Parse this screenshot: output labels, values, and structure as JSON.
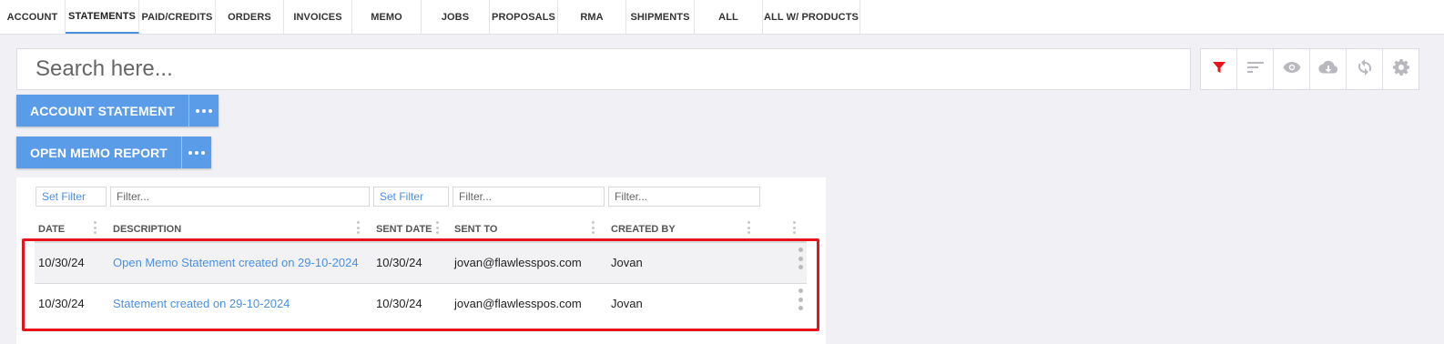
{
  "tabs": [
    {
      "label": "ACCOUNT",
      "active": false
    },
    {
      "label": "STATEMENTS",
      "active": true
    },
    {
      "label": "PAID/CREDITS",
      "active": false
    },
    {
      "label": "ORDERS",
      "active": false
    },
    {
      "label": "INVOICES",
      "active": false
    },
    {
      "label": "MEMO",
      "active": false
    },
    {
      "label": "JOBS",
      "active": false
    },
    {
      "label": "PROPOSALS",
      "active": false
    },
    {
      "label": "RMA",
      "active": false
    },
    {
      "label": "SHIPMENTS",
      "active": false
    },
    {
      "label": "ALL",
      "active": false
    },
    {
      "label": "ALL W/ PRODUCTS",
      "active": false
    }
  ],
  "search": {
    "placeholder": "Search here..."
  },
  "toolbar": {
    "icons": [
      "filter-icon",
      "sort-icon",
      "eye-icon",
      "cloud-download-icon",
      "sync-icon",
      "gear-icon"
    ],
    "filter_color": "#e8141b",
    "icon_color": "#b8b8be"
  },
  "actions": {
    "account_statement": "ACCOUNT STATEMENT",
    "open_memo_report": "OPEN MEMO REPORT",
    "button_color": "#5b9ce8"
  },
  "filters": {
    "set_filter_1": "Set Filter",
    "filter_placeholder_1": "Filter...",
    "set_filter_2": "Set Filter",
    "filter_placeholder_2": "Filter...",
    "filter_placeholder_3": "Filter..."
  },
  "columns": {
    "date": "DATE",
    "description": "DESCRIPTION",
    "sent_date": "SENT DATE",
    "sent_to": "SENT TO",
    "created_by": "CREATED BY"
  },
  "rows": [
    {
      "date": "10/30/24",
      "description": "Open Memo Statement created on 29-10-2024",
      "sent_date": "10/30/24",
      "sent_to": "jovan@flawlesspos.com",
      "created_by": "Jovan"
    },
    {
      "date": "10/30/24",
      "description": "Statement created on 29-10-2024",
      "sent_date": "10/30/24",
      "sent_to": "jovan@flawlesspos.com",
      "created_by": "Jovan"
    }
  ],
  "highlight_color": "#e8141b"
}
